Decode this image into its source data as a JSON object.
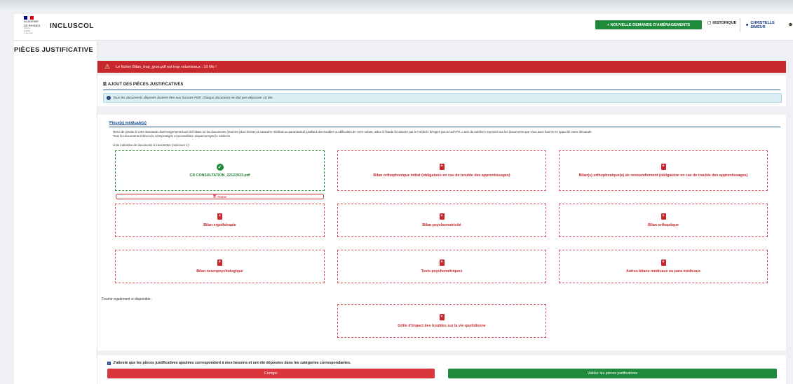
{
  "header": {
    "logo_lines": [
      "ACADÉMIE",
      "DE RENNES"
    ],
    "logo_sub": [
      "Liberté",
      "Égalité",
      "Fraternité"
    ],
    "app_name": "INCLUSCOL",
    "new_request_label": "+ NOUVELLE DEMANDE D'AMÉNAGEMENTS",
    "history_label": "HISTORIQUE",
    "user_name": "CHRISTELLE SIMEUR",
    "flag_colors": [
      "#000091",
      "#ffffff",
      "#e1000f"
    ]
  },
  "page_title": "PIÈCES JUSTIFICATIVE",
  "alert": {
    "message": "Le fichier Bilan_trop_gros.pdf est trop volumineux : 10 Mo !"
  },
  "ajout": {
    "title": "AJOUT DES PIÈCES JUSTIFICATIVES",
    "info": "Tous les documents déposés doivent être aux formats PDF. Chaque document ne doit pas dépasser 10 Mo."
  },
  "medical": {
    "title": "Pièce(s) médicale(s)",
    "description": "Merci de joindre à votre demande d'aménagements tous les bilans ou les documents (dont les plus récents) à caractère médical ou paramédical justifiant des troubles ou difficultés de votre enfant, utiles à l'étude du dossier par le médecin désigné par la CDAPH. L'avis du médecin reposera sur les documents que vous avez fournis en appui de votre demande.",
    "description2": "Tous les documents téléversés sont protégés et accessibles uniquement par le médecin.",
    "list_label": "Liste indicative de documents à transmettre (minimum 1) :",
    "uploaded_file": "CR CONSULTATION_22122023.pdf",
    "remove_label": "Retirer",
    "tiles": [
      "Bilan orthophonique initial (obligatoire en cas de trouble des apprentissages)",
      "Bilan(s) orthophonique(s) de renouvellement (obligatoire en cas de trouble des apprentissages)",
      "Bilan ergothérapie",
      "Bilan psychomotricité",
      "Bilan orthoptique",
      "Bilan neuropsychologique",
      "Tests psychométriques",
      "Autres bilans médicaux ou para médicaux"
    ],
    "also_label": "Fournir également si disponible :",
    "extra_tile": "Grille d'impact des troubles sur la vie quotidienne"
  },
  "footer": {
    "attest": "J'atteste que les pièces justificatives ajoutées correspondent à mes besoins et ont été déposées dans les catégories correspondantes.",
    "fix_label": "Corriger",
    "validate_label": "Valider les pièces justificatives"
  },
  "colors": {
    "danger": "#c8272d",
    "success": "#1e8a3a",
    "primary": "#1b4a8a"
  }
}
